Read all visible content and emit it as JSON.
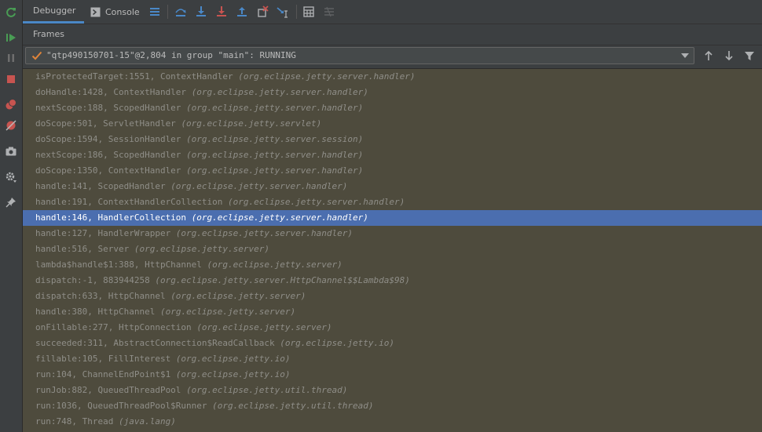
{
  "tabs": [
    {
      "label": "Debugger",
      "active": true
    },
    {
      "label": "Console",
      "active": false
    }
  ],
  "frames_label": "Frames",
  "thread": {
    "label": "\"qtp490150701-15\"@2,804 in group \"main\": RUNNING"
  },
  "colors": {
    "accent": "#4a88c7",
    "selected_row": "#4b6eaf",
    "list_background": "#4e4b3d",
    "resume_green": "#499c54",
    "stop_red": "#c75450"
  },
  "icons": {
    "side": [
      "rerun-icon",
      "resume-icon",
      "pause-icon",
      "stop-icon",
      "view-breakpoints-icon",
      "mute-breakpoints-icon",
      "camera-icon",
      "settings-icon",
      "pin-icon"
    ],
    "toolbar": [
      "console-icon",
      "menu-icon",
      "step-over-icon",
      "step-into-icon",
      "force-step-into-icon",
      "step-out-icon",
      "drop-frame-icon",
      "run-to-cursor-icon",
      "evaluate-icon",
      "trace-icon"
    ]
  },
  "frames": [
    {
      "method": "isProtectedTarget:1551, ContextHandler ",
      "pkg": "(org.eclipse.jetty.server.handler)"
    },
    {
      "method": "doHandle:1428, ContextHandler ",
      "pkg": "(org.eclipse.jetty.server.handler)"
    },
    {
      "method": "nextScope:188, ScopedHandler ",
      "pkg": "(org.eclipse.jetty.server.handler)"
    },
    {
      "method": "doScope:501, ServletHandler ",
      "pkg": "(org.eclipse.jetty.servlet)"
    },
    {
      "method": "doScope:1594, SessionHandler ",
      "pkg": "(org.eclipse.jetty.server.session)"
    },
    {
      "method": "nextScope:186, ScopedHandler ",
      "pkg": "(org.eclipse.jetty.server.handler)"
    },
    {
      "method": "doScope:1350, ContextHandler ",
      "pkg": "(org.eclipse.jetty.server.handler)"
    },
    {
      "method": "handle:141, ScopedHandler ",
      "pkg": "(org.eclipse.jetty.server.handler)"
    },
    {
      "method": "handle:191, ContextHandlerCollection ",
      "pkg": "(org.eclipse.jetty.server.handler)"
    },
    {
      "method": "handle:146, HandlerCollection ",
      "pkg": "(org.eclipse.jetty.server.handler)",
      "selected": true
    },
    {
      "method": "handle:127, HandlerWrapper ",
      "pkg": "(org.eclipse.jetty.server.handler)"
    },
    {
      "method": "handle:516, Server ",
      "pkg": "(org.eclipse.jetty.server)"
    },
    {
      "method": "lambda$handle$1:388, HttpChannel ",
      "pkg": "(org.eclipse.jetty.server)"
    },
    {
      "method": "dispatch:-1, 883944258 ",
      "pkg": "(org.eclipse.jetty.server.HttpChannel$$Lambda$98)"
    },
    {
      "method": "dispatch:633, HttpChannel ",
      "pkg": "(org.eclipse.jetty.server)"
    },
    {
      "method": "handle:380, HttpChannel ",
      "pkg": "(org.eclipse.jetty.server)"
    },
    {
      "method": "onFillable:277, HttpConnection ",
      "pkg": "(org.eclipse.jetty.server)"
    },
    {
      "method": "succeeded:311, AbstractConnection$ReadCallback ",
      "pkg": "(org.eclipse.jetty.io)"
    },
    {
      "method": "fillable:105, FillInterest ",
      "pkg": "(org.eclipse.jetty.io)"
    },
    {
      "method": "run:104, ChannelEndPoint$1 ",
      "pkg": "(org.eclipse.jetty.io)"
    },
    {
      "method": "runJob:882, QueuedThreadPool ",
      "pkg": "(org.eclipse.jetty.util.thread)"
    },
    {
      "method": "run:1036, QueuedThreadPool$Runner ",
      "pkg": "(org.eclipse.jetty.util.thread)"
    },
    {
      "method": "run:748, Thread ",
      "pkg": "(java.lang)"
    }
  ]
}
